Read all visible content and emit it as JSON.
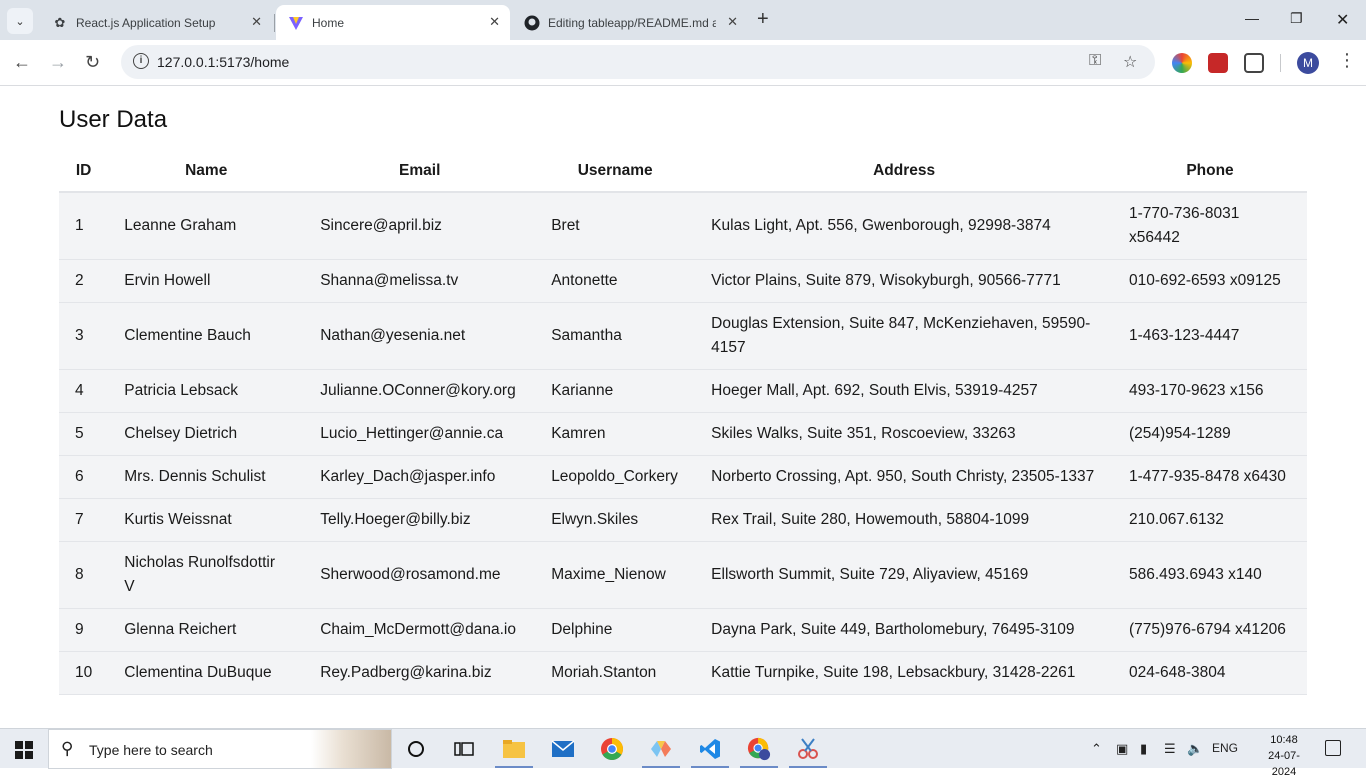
{
  "browser": {
    "tabs": [
      {
        "title": "React.js Application Setup",
        "icon": "openai-icon"
      },
      {
        "title": "Home",
        "icon": "vite-icon"
      },
      {
        "title": "Editing tableapp/README.md a",
        "icon": "github-icon"
      }
    ],
    "url": "127.0.0.1:5173/home"
  },
  "page": {
    "title": "User Data",
    "columns": [
      "ID",
      "Name",
      "Email",
      "Username",
      "Address",
      "Phone"
    ],
    "rows": [
      {
        "id": "1",
        "name": "Leanne Graham",
        "email": "Sincere@april.biz",
        "username": "Bret",
        "address": "Kulas Light, Apt. 556, Gwenborough, 92998-3874",
        "phone": "1-770-736-8031 x56442"
      },
      {
        "id": "2",
        "name": "Ervin Howell",
        "email": "Shanna@melissa.tv",
        "username": "Antonette",
        "address": "Victor Plains, Suite 879, Wisokyburgh, 90566-7771",
        "phone": "010-692-6593 x09125"
      },
      {
        "id": "3",
        "name": "Clementine Bauch",
        "email": "Nathan@yesenia.net",
        "username": "Samantha",
        "address": "Douglas Extension, Suite 847, McKenziehaven, 59590-4157",
        "phone": "1-463-123-4447"
      },
      {
        "id": "4",
        "name": "Patricia Lebsack",
        "email": "Julianne.OConner@kory.org",
        "username": "Karianne",
        "address": "Hoeger Mall, Apt. 692, South Elvis, 53919-4257",
        "phone": "493-170-9623 x156"
      },
      {
        "id": "5",
        "name": "Chelsey Dietrich",
        "email": "Lucio_Hettinger@annie.ca",
        "username": "Kamren",
        "address": "Skiles Walks, Suite 351, Roscoeview, 33263",
        "phone": "(254)954-1289"
      },
      {
        "id": "6",
        "name": "Mrs. Dennis Schulist",
        "email": "Karley_Dach@jasper.info",
        "username": "Leopoldo_Corkery",
        "address": "Norberto Crossing, Apt. 950, South Christy, 23505-1337",
        "phone": "1-477-935-8478 x6430"
      },
      {
        "id": "7",
        "name": "Kurtis Weissnat",
        "email": "Telly.Hoeger@billy.biz",
        "username": "Elwyn.Skiles",
        "address": "Rex Trail, Suite 280, Howemouth, 58804-1099",
        "phone": "210.067.6132"
      },
      {
        "id": "8",
        "name": "Nicholas Runolfsdottir V",
        "email": "Sherwood@rosamond.me",
        "username": "Maxime_Nienow",
        "address": "Ellsworth Summit, Suite 729, Aliyaview, 45169",
        "phone": "586.493.6943 x140"
      },
      {
        "id": "9",
        "name": "Glenna Reichert",
        "email": "Chaim_McDermott@dana.io",
        "username": "Delphine",
        "address": "Dayna Park, Suite 449, Bartholomebury, 76495-3109",
        "phone": "(775)976-6794 x41206"
      },
      {
        "id": "10",
        "name": "Clementina DuBuque",
        "email": "Rey.Padberg@karina.biz",
        "username": "Moriah.Stanton",
        "address": "Kattie Turnpike, Suite 198, Lebsackbury, 31428-2261",
        "phone": "024-648-3804"
      }
    ]
  },
  "taskbar": {
    "search_placeholder": "Type here to search",
    "language": "ENG",
    "time": "10:48",
    "date": "24-07-2024"
  },
  "profile": {
    "initial": "M"
  }
}
